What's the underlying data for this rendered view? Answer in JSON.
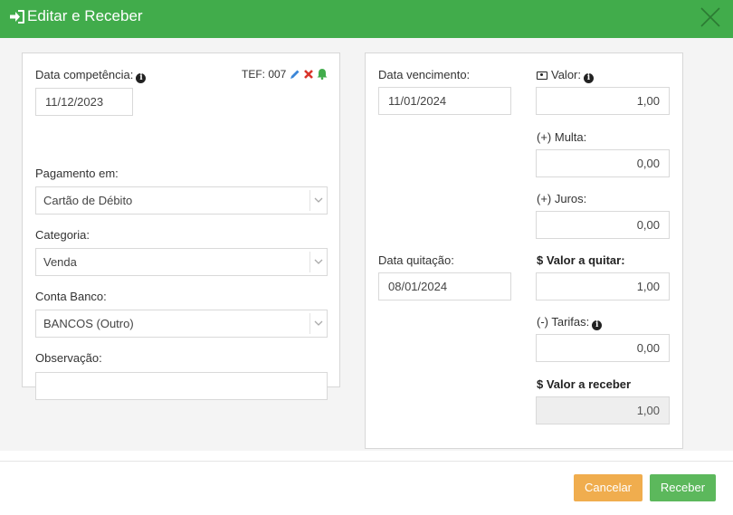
{
  "modal": {
    "title": "Editar e Receber"
  },
  "left": {
    "data_competencia": {
      "label": "Data competência:",
      "value": "11/12/2023"
    },
    "tef": {
      "label": "TEF: 007"
    },
    "pagamento": {
      "label": "Pagamento em:",
      "value": "Cartão de Débito"
    },
    "categoria": {
      "label": "Categoria:",
      "value": "Venda"
    },
    "conta_banco": {
      "label": "Conta Banco:",
      "value": "BANCOS (Outro)"
    },
    "observacao": {
      "label": "Observação:",
      "value": ""
    }
  },
  "right": {
    "data_vencimento": {
      "label": "Data vencimento:",
      "value": "11/01/2024"
    },
    "data_quitacao": {
      "label": "Data quitação:",
      "value": "08/01/2024"
    },
    "valor": {
      "label": "Valor:",
      "value": "1,00"
    },
    "multa": {
      "label": "(+) Multa:",
      "value": "0,00"
    },
    "juros": {
      "label": "(+) Juros:",
      "value": "0,00"
    },
    "valor_quitar": {
      "label": "$ Valor a quitar:",
      "value": "1,00"
    },
    "tarifas": {
      "label": "(-) Tarifas:",
      "value": "0,00"
    },
    "valor_receber": {
      "label": "$ Valor a receber",
      "value": "1,00"
    }
  },
  "footer": {
    "cancel_label": "Cancelar",
    "receive_label": "Receber"
  },
  "icons": {
    "title": "sign-in-icon",
    "close": "close-icon",
    "info": "info-circle-icon",
    "edit": "pencil-icon",
    "delete": "times-icon",
    "notify": "bell-icon",
    "money": "money-icon",
    "dropdown": "chevron-down-icon"
  },
  "colors": {
    "header": "#41ac4b",
    "edit": "#3b86d8",
    "delete": "#d9342b",
    "notify": "#41ac4b",
    "cancel": "#f0ad4e",
    "receive": "#5cb85c"
  }
}
